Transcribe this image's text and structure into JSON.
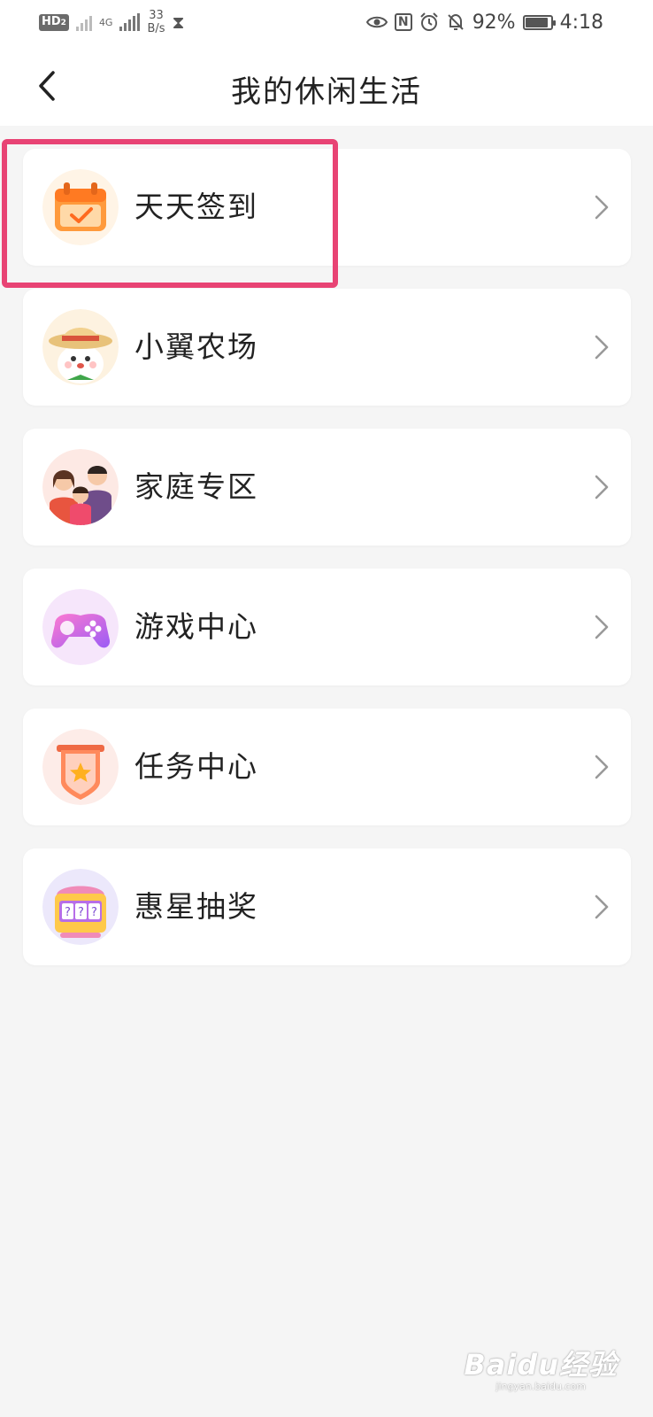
{
  "status_bar": {
    "hd": "HD",
    "hd_sub": "2",
    "net_type": "4G",
    "speed_value": "33",
    "speed_unit": "B/s",
    "battery_percent": "92%",
    "battery_level": 0.92,
    "time": "4:18",
    "icons": [
      "eye-icon",
      "nfc-icon",
      "alarm-icon",
      "bell-off-icon",
      "battery-icon"
    ]
  },
  "header": {
    "title": "我的休闲生活",
    "back_icon": "chevron-left-icon"
  },
  "items": [
    {
      "label": "天天签到",
      "icon": "calendar-check-icon"
    },
    {
      "label": "小翼农场",
      "icon": "farm-mascot-icon"
    },
    {
      "label": "家庭专区",
      "icon": "family-icon"
    },
    {
      "label": "游戏中心",
      "icon": "gamepad-icon"
    },
    {
      "label": "任务中心",
      "icon": "task-star-icon"
    },
    {
      "label": "惠星抽奖",
      "icon": "slot-machine-icon"
    }
  ],
  "highlight": {
    "target": "天天签到",
    "color": "#e84374"
  },
  "watermark": {
    "logo": "Baidu经验",
    "url": "jingyan.baidu.com"
  },
  "colors": {
    "background": "#f5f5f5",
    "card": "#ffffff",
    "highlight": "#e84374",
    "chevron": "#999999"
  }
}
